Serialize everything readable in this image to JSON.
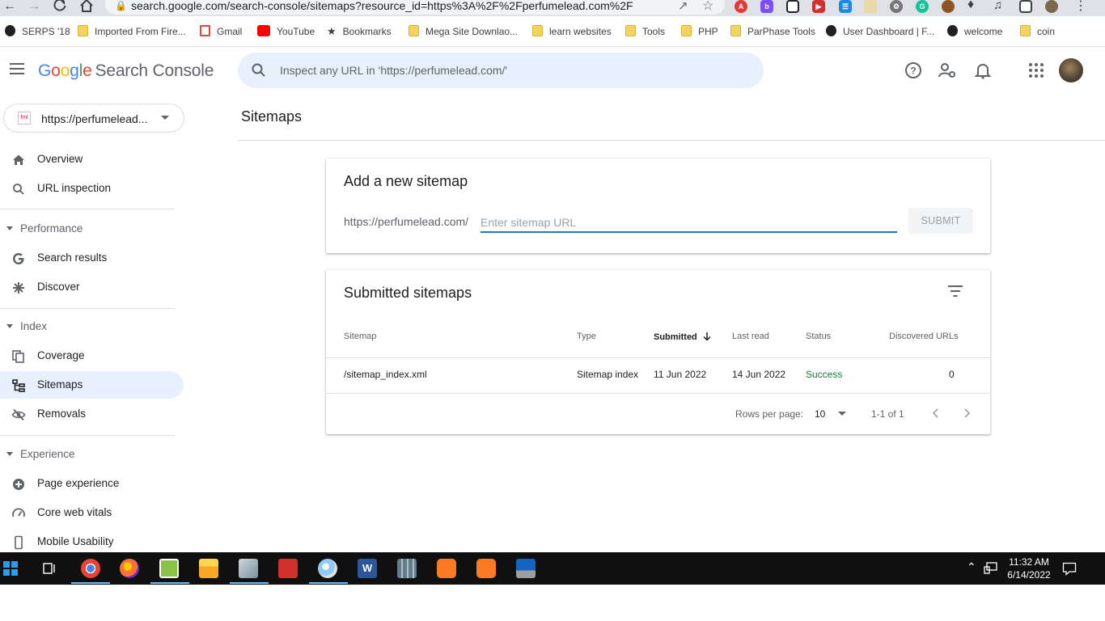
{
  "browser": {
    "url": "search.google.com/search-console/sitemaps?resource_id=https%3A%2F%2Fperfumelead.com%2F",
    "bookmarks": [
      {
        "label": "SERPS '18",
        "icon": "globe-icon"
      },
      {
        "label": "Imported From Fire...",
        "icon": "folder-icon"
      },
      {
        "label": "Gmail",
        "icon": "gmail-icon"
      },
      {
        "label": "YouTube",
        "icon": "youtube-icon"
      },
      {
        "label": "Bookmarks",
        "icon": "star-icon"
      },
      {
        "label": "Mega Site Downlao...",
        "icon": "folder-icon"
      },
      {
        "label": "learn websites",
        "icon": "folder-icon"
      },
      {
        "label": "Tools",
        "icon": "folder-icon"
      },
      {
        "label": "PHP",
        "icon": "folder-icon"
      },
      {
        "label": "ParPhase Tools",
        "icon": "folder-icon"
      },
      {
        "label": "User Dashboard | F...",
        "icon": "globe-icon"
      },
      {
        "label": "welcome",
        "icon": "globe-icon"
      },
      {
        "label": "coin",
        "icon": "folder-icon"
      }
    ]
  },
  "header": {
    "logo_google": [
      "G",
      "o",
      "o",
      "g",
      "l",
      "e"
    ],
    "logo_rest": "Search Console",
    "search_placeholder": "Inspect any URL in 'https://perfumelead.com/'"
  },
  "sidebar": {
    "property": "https://perfumelead...",
    "items_top": [
      {
        "label": "Overview",
        "icon": "home-icon"
      },
      {
        "label": "URL inspection",
        "icon": "search-icon"
      }
    ],
    "performance": {
      "label": "Performance",
      "items": [
        {
          "label": "Search results",
          "icon": "google-g-icon"
        },
        {
          "label": "Discover",
          "icon": "asterisk-icon"
        }
      ]
    },
    "index": {
      "label": "Index",
      "items": [
        {
          "label": "Coverage",
          "icon": "copy-icon"
        },
        {
          "label": "Sitemaps",
          "icon": "sitemap-icon"
        },
        {
          "label": "Removals",
          "icon": "eye-off-icon"
        }
      ]
    },
    "experience": {
      "label": "Experience",
      "items": [
        {
          "label": "Page experience",
          "icon": "plus-circle-icon"
        },
        {
          "label": "Core web vitals",
          "icon": "gauge-icon"
        },
        {
          "label": "Mobile Usability",
          "icon": "phone-icon"
        }
      ]
    }
  },
  "main": {
    "page_title": "Sitemaps",
    "add_card": {
      "title": "Add a new sitemap",
      "prefix": "https://perfumelead.com/",
      "input_placeholder": "Enter sitemap URL",
      "submit_label": "SUBMIT"
    },
    "list_card": {
      "title": "Submitted sitemaps",
      "columns": [
        "Sitemap",
        "Type",
        "Submitted",
        "Last read",
        "Status",
        "Discovered URLs"
      ],
      "rows": [
        {
          "sitemap": "/sitemap_index.xml",
          "type": "Sitemap index",
          "submitted": "11 Jun 2022",
          "last_read": "14 Jun 2022",
          "status": "Success",
          "discovered": "0"
        }
      ],
      "rows_per_page_label": "Rows per page:",
      "rows_per_page_value": "10",
      "range": "1-1 of 1"
    }
  },
  "taskbar": {
    "time": "11:32 AM",
    "date": "6/14/2022"
  },
  "colors": {
    "accent": "#1a73e8",
    "active_nav": "#e8f0fe",
    "success": "#188038"
  }
}
